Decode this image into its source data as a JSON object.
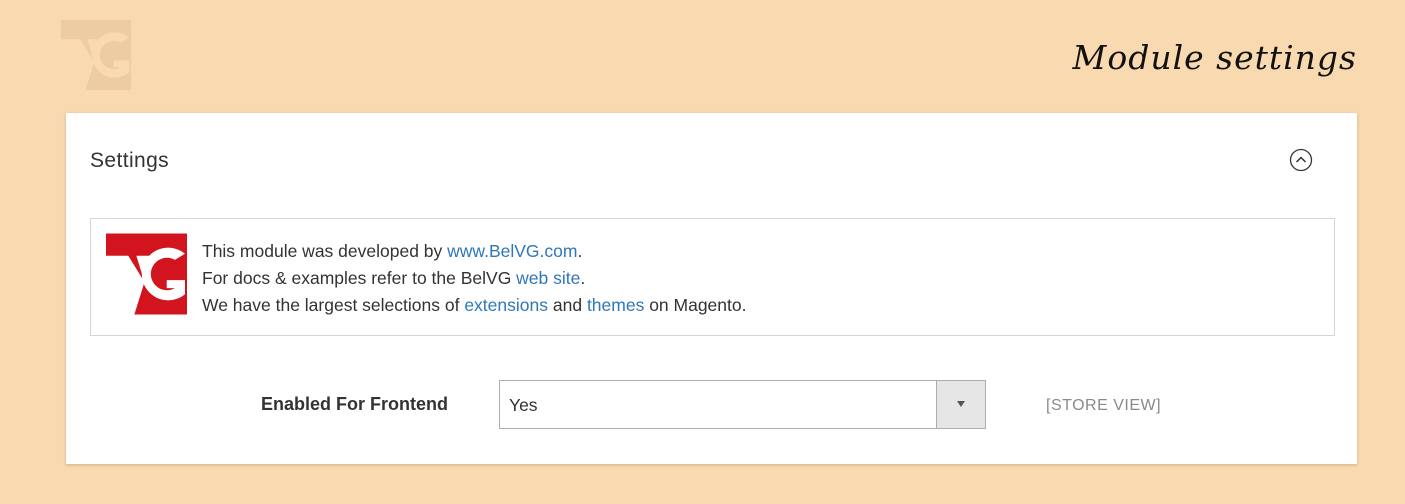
{
  "header": {
    "title": "Module settings"
  },
  "panel": {
    "title": "Settings"
  },
  "info": {
    "line1_prefix": "This module was developed by ",
    "line1_link": "www.BelVG.com",
    "line1_suffix": ".",
    "line2_prefix": "For docs & examples refer to the BelVG ",
    "line2_link": "web site",
    "line2_suffix": ".",
    "line3_prefix": "We have the largest selections of ",
    "line3_link1": "extensions",
    "line3_middle": " and ",
    "line3_link2": "themes",
    "line3_suffix": " on Magento."
  },
  "field": {
    "label": "Enabled For Frontend",
    "value": "Yes",
    "scope": "[STORE VIEW]"
  },
  "logo": {
    "text": "BelVG"
  },
  "colors": {
    "background": "#f8d9b0",
    "brand_red": "#d2141e",
    "link": "#2f78b7"
  }
}
